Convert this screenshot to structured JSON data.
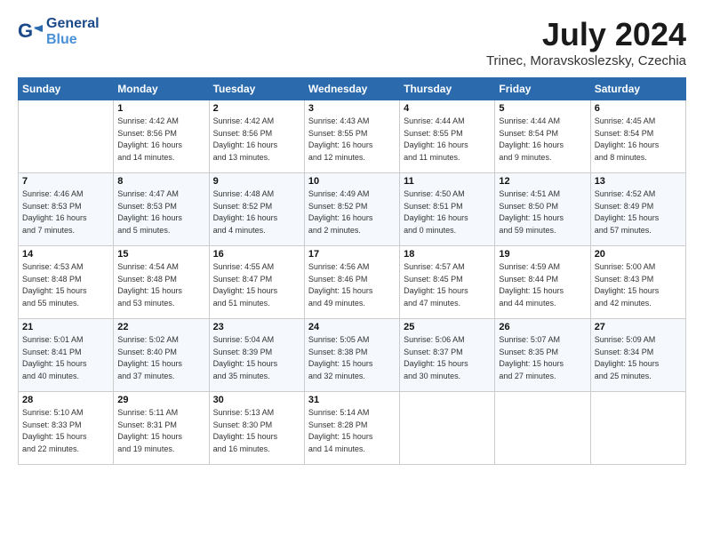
{
  "header": {
    "logo_line1": "General",
    "logo_line2": "Blue",
    "month": "July 2024",
    "location": "Trinec, Moravskoslezsky, Czechia"
  },
  "weekdays": [
    "Sunday",
    "Monday",
    "Tuesday",
    "Wednesday",
    "Thursday",
    "Friday",
    "Saturday"
  ],
  "weeks": [
    [
      {
        "day": "",
        "info": ""
      },
      {
        "day": "1",
        "info": "Sunrise: 4:42 AM\nSunset: 8:56 PM\nDaylight: 16 hours\nand 14 minutes."
      },
      {
        "day": "2",
        "info": "Sunrise: 4:42 AM\nSunset: 8:56 PM\nDaylight: 16 hours\nand 13 minutes."
      },
      {
        "day": "3",
        "info": "Sunrise: 4:43 AM\nSunset: 8:55 PM\nDaylight: 16 hours\nand 12 minutes."
      },
      {
        "day": "4",
        "info": "Sunrise: 4:44 AM\nSunset: 8:55 PM\nDaylight: 16 hours\nand 11 minutes."
      },
      {
        "day": "5",
        "info": "Sunrise: 4:44 AM\nSunset: 8:54 PM\nDaylight: 16 hours\nand 9 minutes."
      },
      {
        "day": "6",
        "info": "Sunrise: 4:45 AM\nSunset: 8:54 PM\nDaylight: 16 hours\nand 8 minutes."
      }
    ],
    [
      {
        "day": "7",
        "info": "Sunrise: 4:46 AM\nSunset: 8:53 PM\nDaylight: 16 hours\nand 7 minutes."
      },
      {
        "day": "8",
        "info": "Sunrise: 4:47 AM\nSunset: 8:53 PM\nDaylight: 16 hours\nand 5 minutes."
      },
      {
        "day": "9",
        "info": "Sunrise: 4:48 AM\nSunset: 8:52 PM\nDaylight: 16 hours\nand 4 minutes."
      },
      {
        "day": "10",
        "info": "Sunrise: 4:49 AM\nSunset: 8:52 PM\nDaylight: 16 hours\nand 2 minutes."
      },
      {
        "day": "11",
        "info": "Sunrise: 4:50 AM\nSunset: 8:51 PM\nDaylight: 16 hours\nand 0 minutes."
      },
      {
        "day": "12",
        "info": "Sunrise: 4:51 AM\nSunset: 8:50 PM\nDaylight: 15 hours\nand 59 minutes."
      },
      {
        "day": "13",
        "info": "Sunrise: 4:52 AM\nSunset: 8:49 PM\nDaylight: 15 hours\nand 57 minutes."
      }
    ],
    [
      {
        "day": "14",
        "info": "Sunrise: 4:53 AM\nSunset: 8:48 PM\nDaylight: 15 hours\nand 55 minutes."
      },
      {
        "day": "15",
        "info": "Sunrise: 4:54 AM\nSunset: 8:48 PM\nDaylight: 15 hours\nand 53 minutes."
      },
      {
        "day": "16",
        "info": "Sunrise: 4:55 AM\nSunset: 8:47 PM\nDaylight: 15 hours\nand 51 minutes."
      },
      {
        "day": "17",
        "info": "Sunrise: 4:56 AM\nSunset: 8:46 PM\nDaylight: 15 hours\nand 49 minutes."
      },
      {
        "day": "18",
        "info": "Sunrise: 4:57 AM\nSunset: 8:45 PM\nDaylight: 15 hours\nand 47 minutes."
      },
      {
        "day": "19",
        "info": "Sunrise: 4:59 AM\nSunset: 8:44 PM\nDaylight: 15 hours\nand 44 minutes."
      },
      {
        "day": "20",
        "info": "Sunrise: 5:00 AM\nSunset: 8:43 PM\nDaylight: 15 hours\nand 42 minutes."
      }
    ],
    [
      {
        "day": "21",
        "info": "Sunrise: 5:01 AM\nSunset: 8:41 PM\nDaylight: 15 hours\nand 40 minutes."
      },
      {
        "day": "22",
        "info": "Sunrise: 5:02 AM\nSunset: 8:40 PM\nDaylight: 15 hours\nand 37 minutes."
      },
      {
        "day": "23",
        "info": "Sunrise: 5:04 AM\nSunset: 8:39 PM\nDaylight: 15 hours\nand 35 minutes."
      },
      {
        "day": "24",
        "info": "Sunrise: 5:05 AM\nSunset: 8:38 PM\nDaylight: 15 hours\nand 32 minutes."
      },
      {
        "day": "25",
        "info": "Sunrise: 5:06 AM\nSunset: 8:37 PM\nDaylight: 15 hours\nand 30 minutes."
      },
      {
        "day": "26",
        "info": "Sunrise: 5:07 AM\nSunset: 8:35 PM\nDaylight: 15 hours\nand 27 minutes."
      },
      {
        "day": "27",
        "info": "Sunrise: 5:09 AM\nSunset: 8:34 PM\nDaylight: 15 hours\nand 25 minutes."
      }
    ],
    [
      {
        "day": "28",
        "info": "Sunrise: 5:10 AM\nSunset: 8:33 PM\nDaylight: 15 hours\nand 22 minutes."
      },
      {
        "day": "29",
        "info": "Sunrise: 5:11 AM\nSunset: 8:31 PM\nDaylight: 15 hours\nand 19 minutes."
      },
      {
        "day": "30",
        "info": "Sunrise: 5:13 AM\nSunset: 8:30 PM\nDaylight: 15 hours\nand 16 minutes."
      },
      {
        "day": "31",
        "info": "Sunrise: 5:14 AM\nSunset: 8:28 PM\nDaylight: 15 hours\nand 14 minutes."
      },
      {
        "day": "",
        "info": ""
      },
      {
        "day": "",
        "info": ""
      },
      {
        "day": "",
        "info": ""
      }
    ]
  ]
}
